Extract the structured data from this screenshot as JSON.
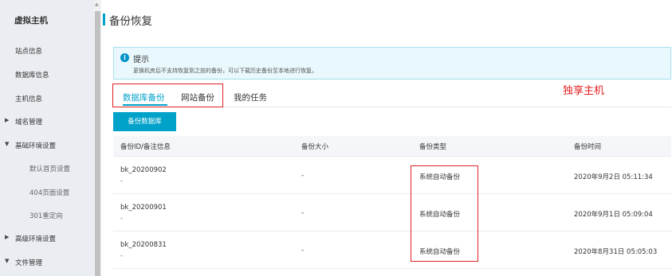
{
  "sidebar": {
    "title": "虚拟主机",
    "items": [
      {
        "label": "站点信息",
        "caret": ""
      },
      {
        "label": "数据库信息",
        "caret": ""
      },
      {
        "label": "主机信息",
        "caret": ""
      },
      {
        "label": "域名管理",
        "caret": "▶"
      },
      {
        "label": "基础环境设置",
        "caret": "▼"
      },
      {
        "label": "默认首页设置",
        "caret": ""
      },
      {
        "label": "404页面设置",
        "caret": ""
      },
      {
        "label": "301重定向",
        "caret": ""
      },
      {
        "label": "高级环境设置",
        "caret": "▶"
      },
      {
        "label": "文件管理",
        "caret": "▼"
      }
    ],
    "scroll_up": "▲"
  },
  "header": {
    "title": "备份恢复"
  },
  "notice": {
    "icon": "i",
    "title": "提示",
    "text": "更换机房后不支持恢复到之前的备份，可以下载历史备份至本地进行恢复。"
  },
  "tabs": [
    {
      "label": "数据库备份",
      "active": true
    },
    {
      "label": "网站备份",
      "active": false
    },
    {
      "label": "我的任务",
      "active": false
    }
  ],
  "backup_button": "备份数据库",
  "annotation": "独享主机",
  "table": {
    "columns": [
      "备份ID/备注信息",
      "备份大小",
      "备份类型",
      "备份时间"
    ],
    "rows": [
      {
        "id": "bk_20200902",
        "note": "-",
        "size": "-",
        "type": "系统自动备份",
        "time": "2020年9月2日 05:11:34"
      },
      {
        "id": "bk_20200901",
        "note": "-",
        "size": "-",
        "type": "系统自动备份",
        "time": "2020年9月1日 05:09:04"
      },
      {
        "id": "bk_20200831",
        "note": "-",
        "size": "-",
        "type": "系统自动备份",
        "time": "2020年8月31日 05:05:03"
      }
    ]
  },
  "colors": {
    "accent": "#00a2ca",
    "highlight": "#e02020",
    "sidebar_bg": "#eaedf1"
  }
}
